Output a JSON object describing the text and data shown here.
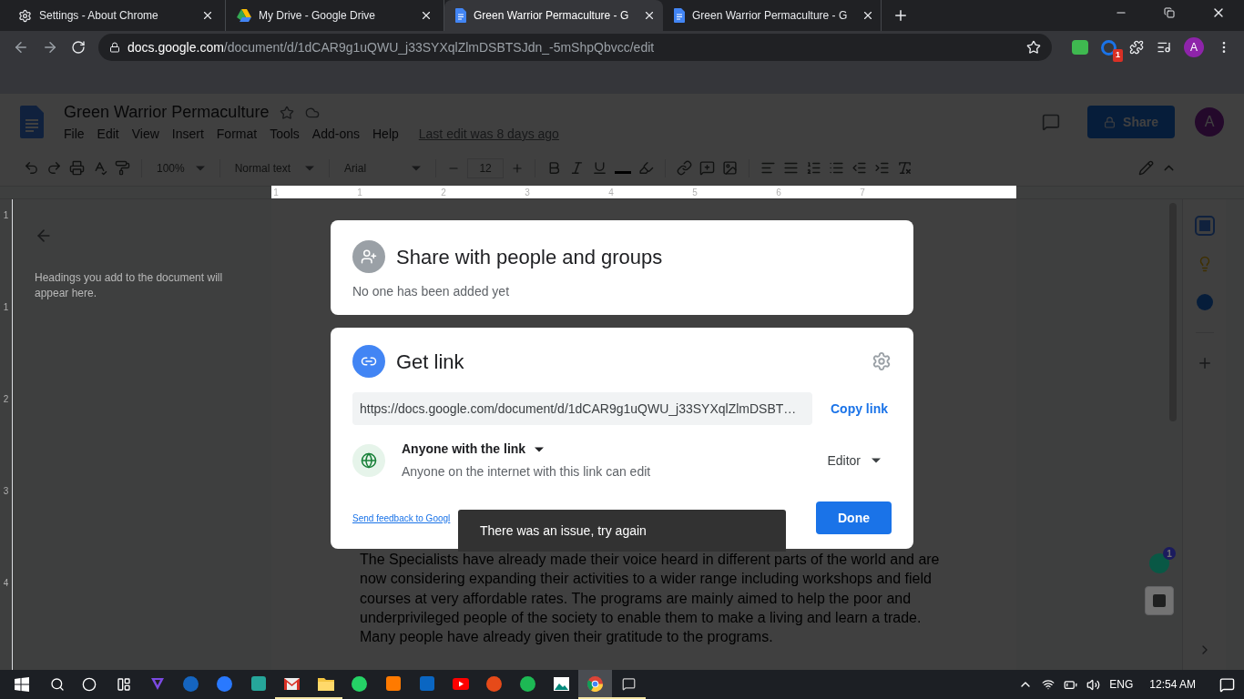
{
  "browser": {
    "tabs": [
      {
        "kind": "settings",
        "title": "Settings - About Chrome",
        "selected": false
      },
      {
        "kind": "drive",
        "title": "My Drive - Google Drive",
        "selected": false
      },
      {
        "kind": "docs",
        "title": "Green Warrior Permaculture - G",
        "selected": true
      },
      {
        "kind": "docs",
        "title": "Green Warrior Permaculture - G",
        "selected": false
      }
    ],
    "url_host": "docs.google.com",
    "url_path": "/document/d/1dCAR9g1uQWU_j33SYXqlZlmDSBTSJdn_-5mShpQbvcc/edit",
    "extension_badge": "1",
    "profile_initial": "A"
  },
  "docs": {
    "title": "Green Warrior Permaculture",
    "menu": [
      "File",
      "Edit",
      "View",
      "Insert",
      "Format",
      "Tools",
      "Add-ons",
      "Help"
    ],
    "last_edit": "Last edit was 8 days ago",
    "share_label": "Share",
    "avatar_initial": "A",
    "toolbar": {
      "zoom": "100%",
      "style": "Normal text",
      "font": "Arial",
      "size": "12"
    },
    "ruler_marks": [
      "1",
      "1",
      "2",
      "3",
      "4",
      "5",
      "6",
      "7"
    ],
    "vertical_ruler_marks": [
      "1",
      "1",
      "2",
      "3",
      "4"
    ],
    "outline_hint": "Headings you add to the document will appear here.",
    "paragraph": "The Specialists have already made their voice heard in different parts of the world and are now considering expanding their activities to a wider range including workshops and field courses at very affordable rates. The programs are mainly aimed to help the poor and underprivileged people of the society to enable them to make a living and learn a trade. Many people have already given their gratitude to the programs.",
    "grammarly_badge": "1"
  },
  "share_dialog": {
    "title": "Share with people and groups",
    "subtitle": "No one has been added yet"
  },
  "link_dialog": {
    "title": "Get link",
    "url": "https://docs.google.com/document/d/1dCAR9g1uQWU_j33SYXqlZlmDSBT…",
    "copy_label": "Copy link",
    "access": "Anyone with the link",
    "access_description": "Anyone on the internet with this link can edit",
    "role": "Editor",
    "feedback": "Send feedback to Googl",
    "done": "Done"
  },
  "toast": "There was an issue, try again",
  "taskbar": {
    "apps": [
      {
        "kind": "shield",
        "open": false,
        "selected": false
      },
      {
        "kind": "blue-p",
        "open": false,
        "selected": false
      },
      {
        "kind": "blue-c",
        "open": false,
        "selected": false
      },
      {
        "kind": "teal-d",
        "open": false,
        "selected": false
      },
      {
        "kind": "mail",
        "open": true,
        "selected": false
      },
      {
        "kind": "folder",
        "open": true,
        "selected": false
      },
      {
        "kind": "whatsapp",
        "open": false,
        "selected": false
      },
      {
        "kind": "orange-c",
        "open": false,
        "selected": false
      },
      {
        "kind": "linkedin",
        "open": false,
        "selected": false
      },
      {
        "kind": "youtube",
        "open": false,
        "selected": false
      },
      {
        "kind": "red-round",
        "open": false,
        "selected": false
      },
      {
        "kind": "green-round",
        "open": false,
        "selected": false
      },
      {
        "kind": "photo",
        "open": false,
        "selected": false
      },
      {
        "kind": "chrome",
        "open": true,
        "selected": true
      },
      {
        "kind": "chat",
        "open": true,
        "selected": false
      }
    ],
    "language": "ENG",
    "time": "12:54 AM"
  }
}
